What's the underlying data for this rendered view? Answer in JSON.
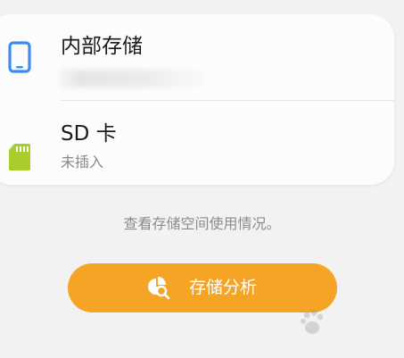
{
  "storage": {
    "internal": {
      "title": "内部存储",
      "icon": "phone-icon"
    },
    "sd": {
      "title": "SD 卡",
      "status": "未插入",
      "icon": "sd-card-icon"
    }
  },
  "hint": "查看存储空间使用情况。",
  "analyze_button": {
    "label": "存储分析",
    "icon": "storage-analysis-icon"
  },
  "colors": {
    "background": "#f2f2f2",
    "card": "#fcfcfc",
    "phone_icon": "#3d8cf5",
    "sd_icon": "#a9cd2a",
    "button": "#f5a426"
  }
}
